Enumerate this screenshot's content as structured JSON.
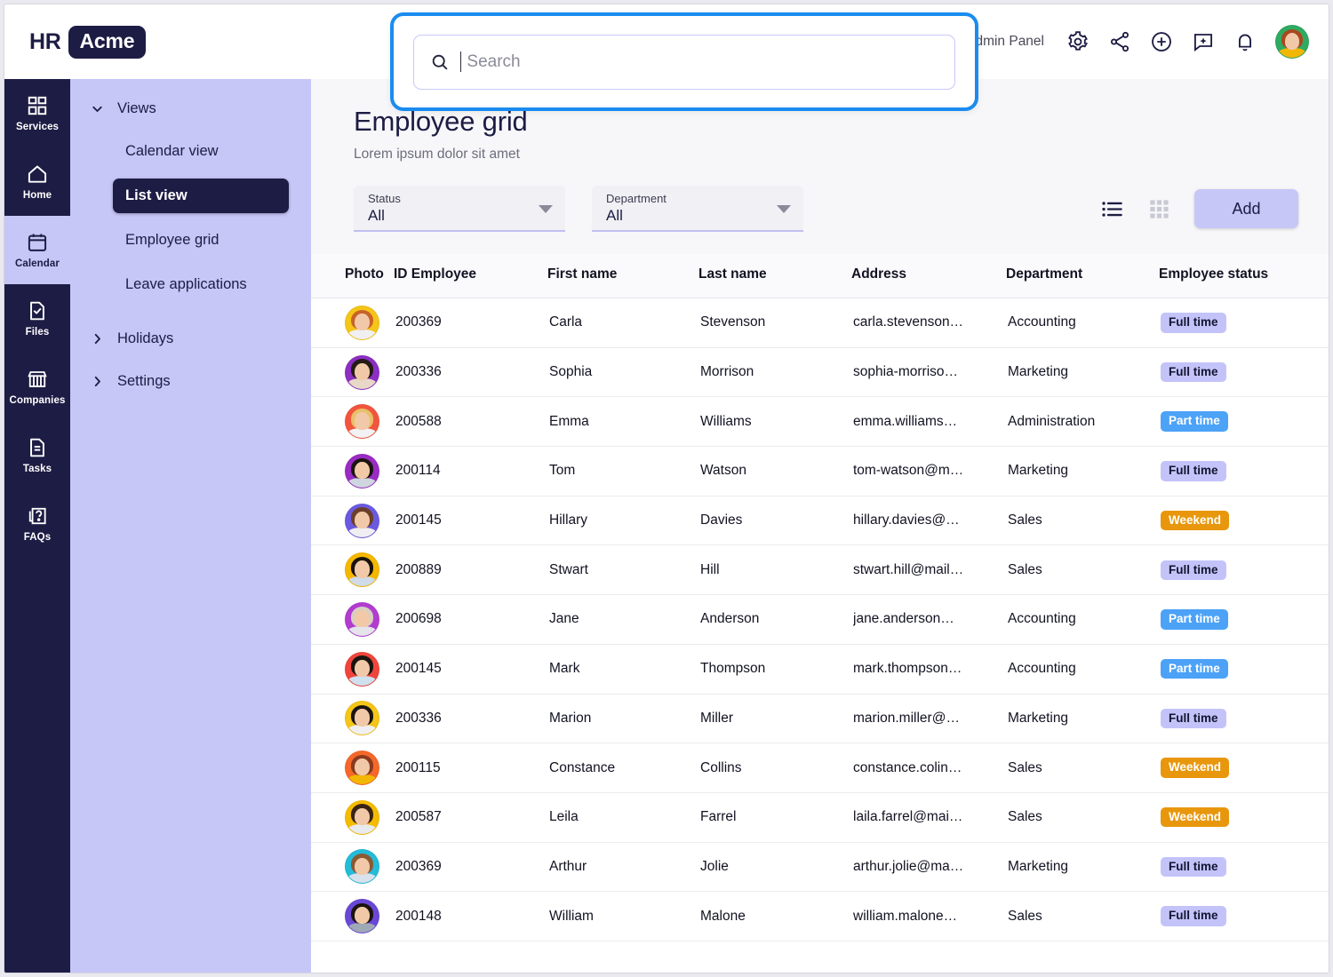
{
  "header": {
    "logo_primary": "HR",
    "logo_badge": "Acme",
    "admin_panel": "Admin Panel",
    "icons": [
      "gear-icon",
      "share-icon",
      "plus-circle-icon",
      "chat-sparkle-icon",
      "bell-icon"
    ],
    "avatar_bg": "#2eab61"
  },
  "search": {
    "placeholder": "Search",
    "value": "",
    "icon": "search-icon",
    "focus_ring_color": "#1a8cf0"
  },
  "rail": {
    "items": [
      {
        "label": "Services",
        "icon": "grid-icon",
        "active": false
      },
      {
        "label": "Home",
        "icon": "home-icon",
        "active": false
      },
      {
        "label": "Calendar",
        "icon": "calendar-icon",
        "active": true
      },
      {
        "label": "Files",
        "icon": "file-check-icon",
        "active": false
      },
      {
        "label": "Companies",
        "icon": "store-icon",
        "active": false
      },
      {
        "label": "Tasks",
        "icon": "document-lines-icon",
        "active": false
      },
      {
        "label": "FAQs",
        "icon": "question-box-icon",
        "active": false
      }
    ]
  },
  "subnav": {
    "groups": [
      {
        "label": "Views",
        "expanded": true,
        "icon": "chevron-down-icon"
      },
      {
        "label": "Holidays",
        "expanded": false,
        "icon": "chevron-right-icon"
      },
      {
        "label": "Settings",
        "expanded": false,
        "icon": "chevron-right-icon"
      }
    ],
    "views_children": [
      {
        "label": "Calendar view",
        "active": false
      },
      {
        "label": "List view",
        "active": true
      },
      {
        "label": "Employee grid",
        "active": false
      },
      {
        "label": "Leave applications",
        "active": false
      }
    ]
  },
  "page": {
    "title": "Employee grid",
    "subtitle": "Lorem ipsum dolor sit amet"
  },
  "toolbar": {
    "status_filter": {
      "label": "Status",
      "value": "All"
    },
    "department_filter": {
      "label": "Department",
      "value": "All"
    },
    "list_view_icon": "list-view-icon",
    "grid_view_icon": "grid-view-icon",
    "add_label": "Add",
    "accent": "#c6c6f7"
  },
  "table": {
    "columns": [
      "Photo",
      "ID Employee",
      "First name",
      "Last name",
      "Address",
      "Department",
      "Employee status"
    ],
    "rows": [
      {
        "id": "200369",
        "first": "Carla",
        "last": "Stevenson",
        "address": "carla.stevenson…",
        "department": "Accounting",
        "status": "Full time",
        "status_type": "full",
        "avatar_bg": "#f5c518",
        "hair": "#c8632a",
        "top": "#f0f0f2"
      },
      {
        "id": "200336",
        "first": "Sophia",
        "last": "Morrison",
        "address": "sophia-morriso…",
        "department": "Marketing",
        "status": "Full time",
        "status_type": "full",
        "avatar_bg": "#8c2fc4",
        "hair": "#241a16",
        "top": "#e8d8c8"
      },
      {
        "id": "200588",
        "first": "Emma",
        "last": "Williams",
        "address": "emma.williams…",
        "department": "Administration",
        "status": "Part time",
        "status_type": "part",
        "avatar_bg": "#f2553d",
        "hair": "#e8c06a",
        "top": "#f2f2f4"
      },
      {
        "id": "200114",
        "first": "Tom",
        "last": "Watson",
        "address": "tom-watson@m…",
        "department": "Marketing",
        "status": "Full time",
        "status_type": "full",
        "avatar_bg": "#9a2bc4",
        "hair": "#1c1410",
        "top": "#cfd6e0"
      },
      {
        "id": "200145",
        "first": "Hillary",
        "last": "Davies",
        "address": "hillary.davies@…",
        "department": "Sales",
        "status": "Weekend",
        "status_type": "weekend",
        "avatar_bg": "#6a5ae0",
        "hair": "#6b3f2a",
        "top": "#f0eef2"
      },
      {
        "id": "200889",
        "first": "Stwart",
        "last": "Hill",
        "address": "stwart.hill@mail…",
        "department": "Sales",
        "status": "Full time",
        "status_type": "full",
        "avatar_bg": "#f5b700",
        "hair": "#19120c",
        "top": "#cfdbe8"
      },
      {
        "id": "200698",
        "first": "Jane",
        "last": "Anderson",
        "address": "jane.anderson…",
        "department": "Accounting",
        "status": "Part time",
        "status_type": "part",
        "avatar_bg": "#b23bd0",
        "hair": "#d9cfc0",
        "top": "#e4e4ea"
      },
      {
        "id": "200145",
        "first": "Mark",
        "last": "Thompson",
        "address": "mark.thompson…",
        "department": "Accounting",
        "status": "Part time",
        "status_type": "part",
        "avatar_bg": "#f0453c",
        "hair": "#1a1410",
        "top": "#cfe0ef"
      },
      {
        "id": "200336",
        "first": "Marion",
        "last": "Miller",
        "address": "marion.miller@…",
        "department": "Marketing",
        "status": "Full time",
        "status_type": "full",
        "avatar_bg": "#f5c518",
        "hair": "#1a1410",
        "top": "#f0f0f2"
      },
      {
        "id": "200115",
        "first": "Constance",
        "last": "Collins",
        "address": "constance.colin…",
        "department": "Sales",
        "status": "Weekend",
        "status_type": "weekend",
        "avatar_bg": "#f5682a",
        "hair": "#8a3a1e",
        "top": "#f2b705"
      },
      {
        "id": "200587",
        "first": "Leila",
        "last": "Farrel",
        "address": "laila.farrel@mai…",
        "department": "Sales",
        "status": "Weekend",
        "status_type": "weekend",
        "avatar_bg": "#f5bb00",
        "hair": "#3a2416",
        "top": "#e9eaee"
      },
      {
        "id": "200369",
        "first": "Arthur",
        "last": "Jolie",
        "address": "arthur.jolie@ma…",
        "department": "Marketing",
        "status": "Full time",
        "status_type": "full",
        "avatar_bg": "#24bcd8",
        "hair": "#8a5a33",
        "top": "#d8e2ec"
      },
      {
        "id": "200148",
        "first": "William",
        "last": "Malone",
        "address": "william.malone…",
        "department": "Sales",
        "status": "Full time",
        "status_type": "full",
        "avatar_bg": "#6a48d6",
        "hair": "#1b1410",
        "top": "#9fa9b6"
      }
    ]
  }
}
